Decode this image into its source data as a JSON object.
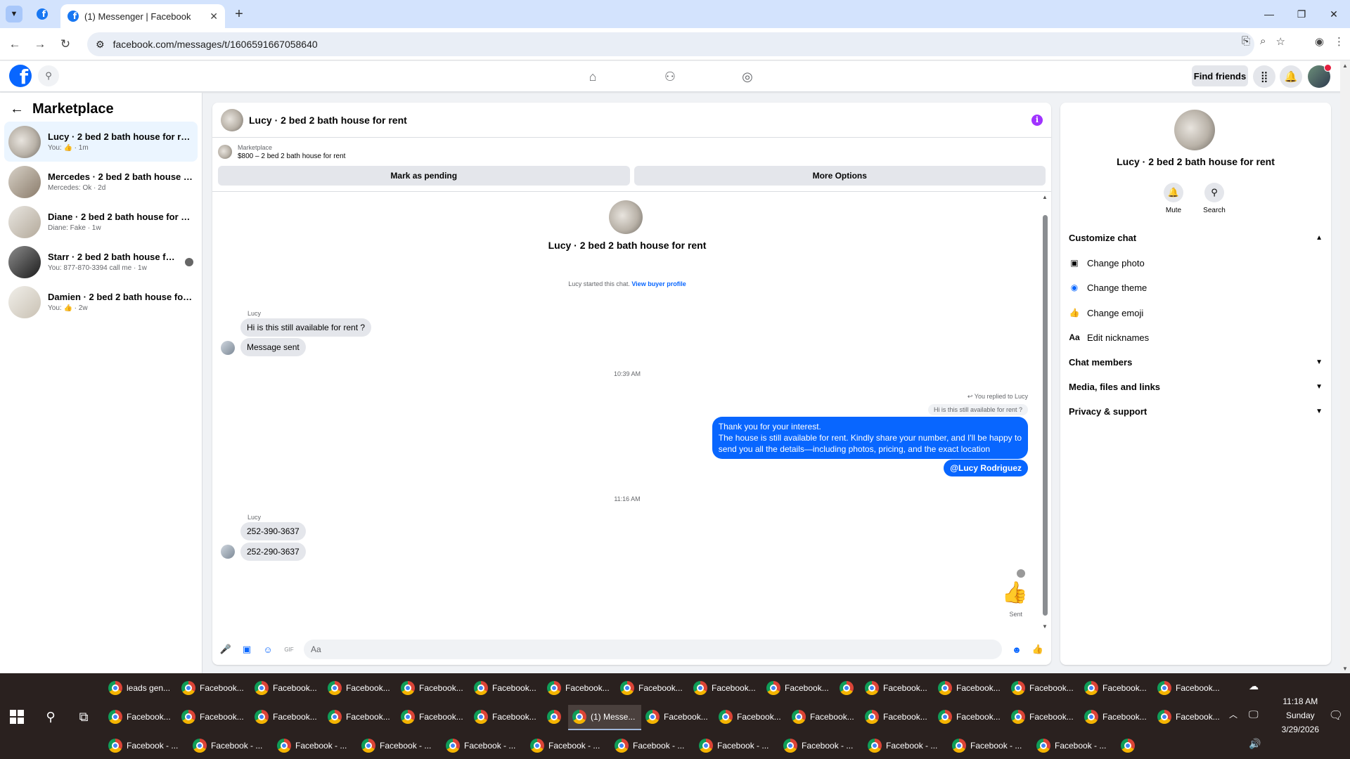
{
  "browser": {
    "tab_title": "(1) Messenger | Facebook",
    "url": "facebook.com/messages/t/1606591667058640",
    "new_tab_symbol": "+",
    "close_symbol": "✕",
    "minimize_symbol": "—",
    "restore_symbol": "❐",
    "window_close_symbol": "✕"
  },
  "header": {
    "find_friends": "Find friends"
  },
  "sidebar": {
    "title": "Marketplace",
    "chats": [
      {
        "name": "Lucy · 2 bed 2 bath house for rent",
        "snippet": "You:",
        "time": "· 1m"
      },
      {
        "name": "Mercedes · 2 bed 2 bath house for...",
        "snippet": "Mercedes: Ok · 2d",
        "time": ""
      },
      {
        "name": "Diane · 2 bed 2 bath house for rent",
        "snippet": "Diane: Fake · 1w",
        "time": ""
      },
      {
        "name": "Starr · 2 bed 2 bath house for rent",
        "snippet": "You: 877-870-3394 call me · 1w",
        "time": ""
      },
      {
        "name": "Damien · 2 bed 2 bath house for r...",
        "snippet": "You:",
        "time": "· 2w"
      }
    ]
  },
  "conversation": {
    "title": "Lucy · 2 bed 2 bath house for rent",
    "listing_source": "Marketplace",
    "listing_title": "$800 – 2 bed 2 bath house for rent",
    "mark_pending": "Mark as pending",
    "more_options": "More Options",
    "thread_name": "Lucy · 2 bed 2 bath house for rent",
    "started_text": "Lucy started this chat.",
    "view_profile": "View buyer profile",
    "sender_1": "Lucy",
    "msg_1": "Hi is this still available for rent ?",
    "msg_2": "Message sent",
    "time_1": "10:39 AM",
    "replied_label": "You replied to Lucy",
    "quoted": "Hi is this still available for rent ?",
    "reply_line_1": "Thank you for your interest.",
    "reply_line_2": "The house is still available for rent. Kindly share your number, and I'll be happy to",
    "reply_line_3": "send you all the details—including photos, pricing, and the exact location",
    "mention": "@Lucy Rodriguez",
    "time_2": "11:16 AM",
    "sender_2": "Lucy",
    "msg_3": "252-390-3637",
    "msg_4": "252-290-3637",
    "sent_label": "Sent",
    "composer_placeholder": "Aa"
  },
  "info_panel": {
    "name": "Lucy · 2 bed 2 bath house for rent",
    "mute": "Mute",
    "search": "Search",
    "customize": "Customize chat",
    "change_photo": "Change photo",
    "change_theme": "Change theme",
    "change_emoji": "Change emoji",
    "edit_nicknames": "Edit nicknames",
    "nickname_icon": "Aa",
    "chat_members": "Chat members",
    "media": "Media, files and links",
    "privacy": "Privacy & support"
  },
  "taskbar": {
    "row1": [
      "leads gen...",
      "Facebook...",
      "Facebook...",
      "Facebook...",
      "Facebook...",
      "Facebook...",
      "Facebook...",
      "Facebook...",
      "Facebook...",
      "Facebook...",
      "",
      "Facebook...",
      "Facebook...",
      "Facebook...",
      "Facebook...",
      "Facebook..."
    ],
    "row2": [
      "Facebook...",
      "Facebook...",
      "Facebook...",
      "Facebook...",
      "Facebook...",
      "Facebook...",
      "",
      "(1) Messe...",
      "Facebook...",
      "Facebook...",
      "Facebook...",
      "Facebook...",
      "Facebook...",
      "Facebook...",
      "Facebook...",
      "Facebook..."
    ],
    "row3": [
      "Facebook - ...",
      "Facebook - ...",
      "Facebook - ...",
      "Facebook - ...",
      "Facebook - ...",
      "Facebook - ...",
      "Facebook - ...",
      "Facebook - ...",
      "Facebook - ...",
      "Facebook - ...",
      "Facebook - ...",
      "Facebook - ...",
      ""
    ],
    "time": "11:18 AM",
    "day": "Sunday",
    "date": "3/29/2026"
  },
  "colors": {
    "accent": "#0866ff",
    "bubble_in": "#e4e6eb",
    "info": "#a033ff"
  }
}
